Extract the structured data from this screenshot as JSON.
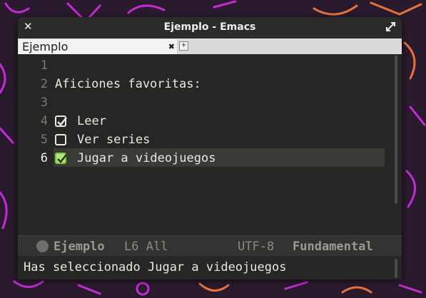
{
  "window": {
    "title": "Ejemplo - Emacs"
  },
  "tabs": [
    {
      "label": "Ejemplo"
    }
  ],
  "editor": {
    "lines": [
      {
        "num": "1",
        "text": ""
      },
      {
        "num": "2",
        "text": "Aficiones favoritas:"
      },
      {
        "num": "3",
        "text": ""
      },
      {
        "num": "4",
        "label": "Leer",
        "checked": true
      },
      {
        "num": "5",
        "label": "Ver series",
        "checked": false
      },
      {
        "num": "6",
        "label": "Jugar a videojuegos",
        "checked": true,
        "current": true
      }
    ]
  },
  "modeline": {
    "buffer": "Ejemplo",
    "position": "L6 All",
    "encoding": "UTF-8",
    "mode": "Fundamental"
  },
  "minibuffer": {
    "message": "Has seleccionado Jugar a videojuegos"
  },
  "colors": {
    "accent_check": "#b5e37a",
    "wallpaper_neon": "#c42bd6",
    "wallpaper_orange": "#e8733a"
  }
}
